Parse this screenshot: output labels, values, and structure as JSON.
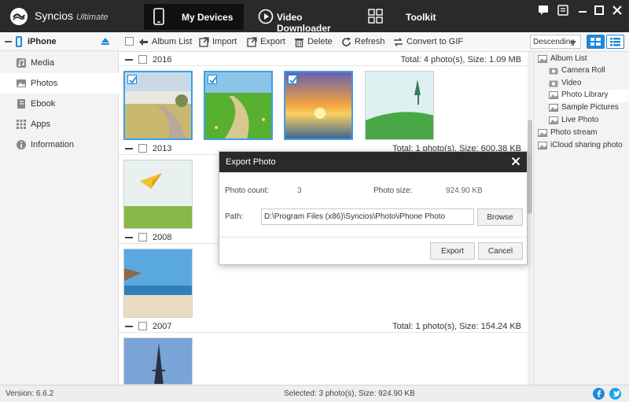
{
  "app": {
    "name": "Syncios",
    "edition": "Ultimate"
  },
  "nav": {
    "tabs": [
      {
        "label": "My Devices",
        "icon": "phone-icon",
        "active": true
      },
      {
        "label": "Video Downloader",
        "icon": "play-icon",
        "active": false
      },
      {
        "label": "Toolkit",
        "icon": "grid-icon",
        "active": false
      }
    ]
  },
  "sidebar": {
    "device": "iPhone",
    "items": [
      {
        "label": "Media",
        "icon": "music-icon"
      },
      {
        "label": "Photos",
        "icon": "photo-icon",
        "active": true
      },
      {
        "label": "Ebook",
        "icon": "book-icon"
      },
      {
        "label": "Apps",
        "icon": "apps-grid-icon"
      },
      {
        "label": "Information",
        "icon": "info-icon"
      }
    ]
  },
  "toolbar": {
    "album_list": "Album List",
    "import": "Import",
    "export": "Export",
    "delete": "Delete",
    "refresh": "Refresh",
    "convert": "Convert to GIF",
    "sort": "Descending"
  },
  "albums": [
    {
      "label": "Album List",
      "level": 0
    },
    {
      "label": "Camera Roll",
      "level": 1
    },
    {
      "label": "Video",
      "level": 1
    },
    {
      "label": "Photo Library",
      "level": 1,
      "active": true
    },
    {
      "label": "Sample Pictures",
      "level": 1
    },
    {
      "label": "Live Photo",
      "level": 1
    },
    {
      "label": "Photo stream",
      "level": 0
    },
    {
      "label": "iCloud sharing photo",
      "level": 0
    }
  ],
  "groups": [
    {
      "year": "2016",
      "total": "Total: 4 photo(s), Size: 1.09 MB"
    },
    {
      "year": "2013",
      "total": "Total: 1 photo(s), Size: 600.38 KB"
    },
    {
      "year": "2008",
      "total": ""
    },
    {
      "year": "2007",
      "total": "Total: 1 photo(s), Size: 154.24 KB"
    }
  ],
  "dialog": {
    "title": "Export Photo",
    "count_label": "Photo count:",
    "count_value": "3",
    "size_label": "Photo size:",
    "size_value": "924.90 KB",
    "path_label": "Path:",
    "path_value": "D:\\Program Files (x86)\\Syncios\\Photo\\iPhone Photo",
    "browse": "Browse",
    "export": "Export",
    "cancel": "Cancel"
  },
  "status": {
    "version": "Version: 6.6.2",
    "selected": "Selected: 3 photo(s), Size: 924.90 KB"
  },
  "colors": {
    "accent": "#1e88d9",
    "titlebar": "#2a2a2a"
  }
}
